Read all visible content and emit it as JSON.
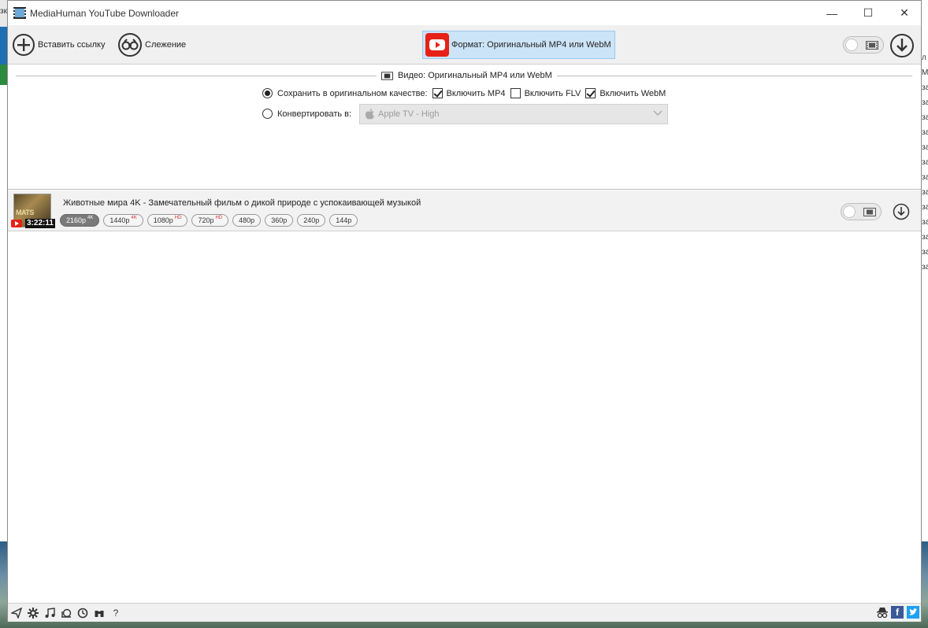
{
  "window": {
    "title": "MediaHuman YouTube Downloader",
    "minimize": "—",
    "maximize": "☐",
    "close": "✕"
  },
  "desktop": {
    "left_text": "зк",
    "right_items": [
      "л",
      "М",
      "за",
      "за",
      "за",
      "за",
      "за",
      "за",
      "за",
      "за",
      "за",
      "за",
      "за",
      "за",
      "за"
    ]
  },
  "toolbar": {
    "paste_label": "Вставить ссылку",
    "tracking_label": "Слежение",
    "format_label": "Формат: Оригинальный MP4 или WebM"
  },
  "settings": {
    "section_title": "Видео: Оригинальный MP4 или WebM",
    "keep_original_label": "Сохранить в оригинальном качестве:",
    "include_mp4": "Включить MP4",
    "include_flv": "Включить FLV",
    "include_webm": "Включить WebM",
    "convert_label": "Конвертировать в:",
    "convert_value": "Apple TV - High"
  },
  "item": {
    "thumb_text": "MATS",
    "duration": "3:22:11",
    "title": "Животные мира 4K - Замечательный фильм о дикой природе с успокаивающей музыкой",
    "qualities": [
      {
        "label": "2160p",
        "tag": "4K"
      },
      {
        "label": "1440p",
        "tag": "4K"
      },
      {
        "label": "1080p",
        "tag": "HD"
      },
      {
        "label": "720p",
        "tag": "HD"
      },
      {
        "label": "480p",
        "tag": ""
      },
      {
        "label": "360p",
        "tag": ""
      },
      {
        "label": "240p",
        "tag": ""
      },
      {
        "label": "144p",
        "tag": ""
      }
    ]
  },
  "statusbar": {
    "help": "?",
    "facebook": "f"
  },
  "colors": {
    "accent": "#cce4f7",
    "accent_border": "#99c9ef",
    "youtube_red": "#e62117",
    "facebook": "#3b5998",
    "twitter": "#1da1f2"
  }
}
